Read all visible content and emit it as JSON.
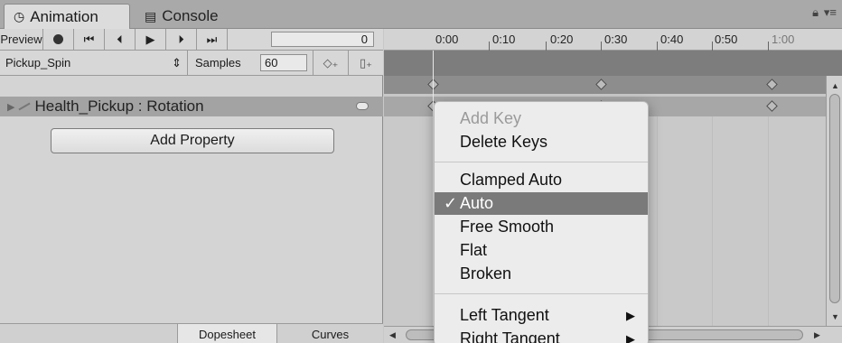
{
  "tabs": [
    {
      "label": "Animation",
      "icon": "clock-icon"
    },
    {
      "label": "Console",
      "icon": "console-icon"
    }
  ],
  "toolbar": {
    "preview_label": "Preview",
    "frame_value": "0",
    "clip_name": "Pickup_Spin",
    "clip_select_arrow": "⇕",
    "samples_label": "Samples",
    "samples_value": "60"
  },
  "property": {
    "label": "Health_Pickup : Rotation"
  },
  "add_property_label": "Add Property",
  "bottom_tabs": {
    "dopesheet": "Dopesheet",
    "curves": "Curves"
  },
  "ruler": {
    "ticks": [
      "0:00",
      "0:10",
      "0:20",
      "0:30",
      "0:40",
      "0:50",
      "1:00"
    ]
  },
  "context_menu": {
    "items": [
      {
        "label": "Add Key",
        "state": "disabled"
      },
      {
        "label": "Delete Keys",
        "state": "normal"
      },
      {
        "label": "Clamped Auto",
        "state": "normal"
      },
      {
        "label": "Auto",
        "state": "selected",
        "checked": true
      },
      {
        "label": "Free Smooth",
        "state": "normal"
      },
      {
        "label": "Flat",
        "state": "normal"
      },
      {
        "label": "Broken",
        "state": "normal"
      },
      {
        "label": "Left Tangent",
        "state": "normal",
        "submenu": true
      },
      {
        "label": "Right Tangent",
        "state": "normal",
        "submenu": true
      }
    ],
    "check_glyph": "✓",
    "submenu_glyph": "▶"
  },
  "colors": {
    "selected_item_bg": "#7a7a7a",
    "summary_band": "#7d7d7d"
  }
}
